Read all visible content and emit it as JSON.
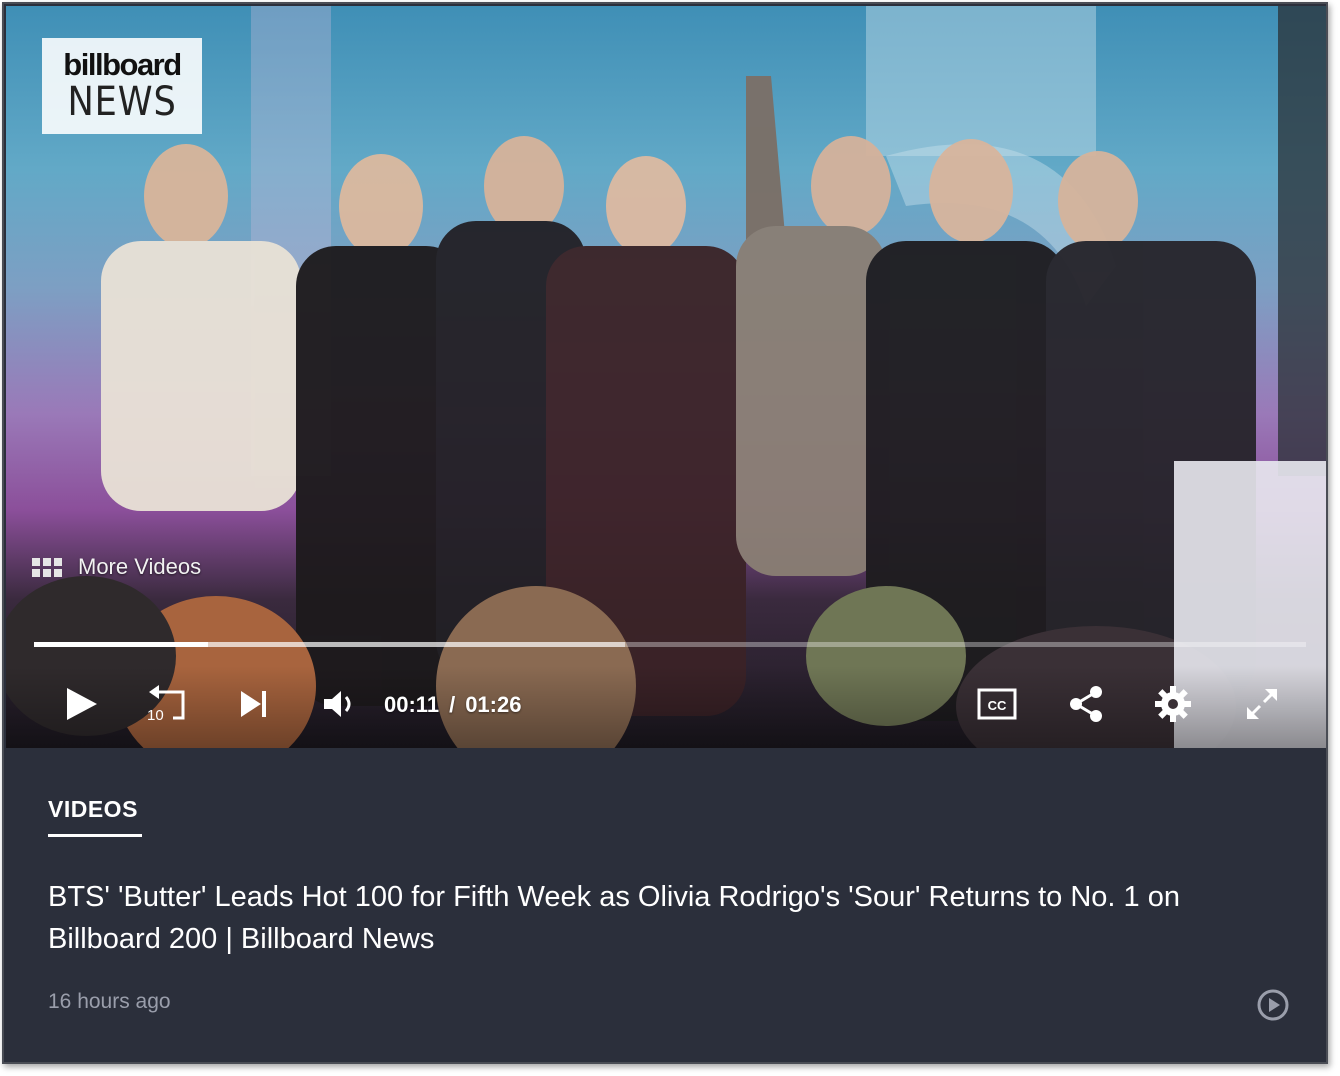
{
  "player": {
    "logo_top": "billboard",
    "logo_bottom": "NEWS",
    "more_videos_label": "More Videos",
    "progress": {
      "played_fraction": 0.137,
      "buffered_fraction": 0.465
    },
    "rewind_seconds": "10",
    "current_time": "00:11",
    "time_separator": "/",
    "duration": "01:26",
    "cc_label": "CC",
    "icons": [
      "grid-icon",
      "play-icon",
      "replay-10-icon",
      "skip-next-icon",
      "volume-icon",
      "captions-icon",
      "share-icon",
      "settings-gear-icon",
      "fullscreen-icon"
    ]
  },
  "info": {
    "section_label": "VIDEOS",
    "headline": "BTS' 'Butter' Leads Hot 100 for Fifth Week as Olivia Rodrigo's 'Sour' Returns to No. 1 on Billboard 200 | Billboard News",
    "timestamp": "16 hours ago",
    "play_icon": "play-circle-icon"
  },
  "colors": {
    "panel_bg": "#2b2f3b",
    "timestamp": "#9a9eab",
    "text": "#ffffff"
  }
}
